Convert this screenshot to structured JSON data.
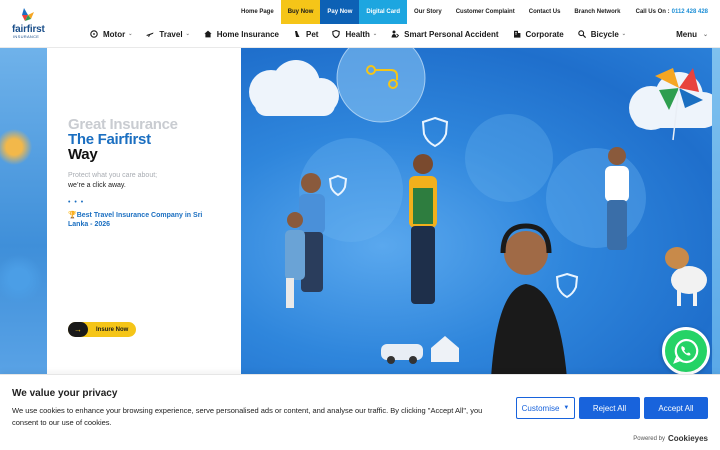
{
  "logo": {
    "wordmark": "fairfirst",
    "sub": "INSURANCE"
  },
  "topbar": {
    "links": [
      "Home Page",
      "Buy Now",
      "Pay Now",
      "Digital Card",
      "Our Story",
      "Customer Complaint",
      "Contact Us",
      "Branch Network"
    ],
    "call_label": "Call Us On :",
    "call_number": "0112 428 428"
  },
  "nav": {
    "items": [
      {
        "label": "Motor",
        "icon": "steering-wheel-icon",
        "dropdown": true
      },
      {
        "label": "Travel",
        "icon": "airplane-icon",
        "dropdown": true
      },
      {
        "label": "Home Insurance",
        "icon": "house-icon",
        "dropdown": false
      },
      {
        "label": "Pet",
        "icon": "paw-icon",
        "dropdown": false
      },
      {
        "label": "Health",
        "icon": "shield-heart-icon",
        "dropdown": true
      },
      {
        "label": "Smart Personal Accident",
        "icon": "person-icon",
        "dropdown": false
      },
      {
        "label": "Corporate",
        "icon": "building-icon",
        "dropdown": false
      },
      {
        "label": "Bicycle",
        "icon": "search-bicycle-icon",
        "dropdown": true
      }
    ],
    "menu_label": "Menu"
  },
  "hero": {
    "line1": "Great Insurance",
    "line2": "The Fairfirst",
    "line3": "Way",
    "sub1": "Protect what you care about;",
    "sub2": "we’re a click away.",
    "dots": "• • •",
    "award": "🏆Best Travel Insurance Company in Sri Lanka - 2026",
    "cta": "Insure Now"
  },
  "cookie": {
    "title": "We value your privacy",
    "text": "We use cookies to enhance your browsing experience, serve personalised ads or content, and analyse our traffic. By clicking \"Accept All\", you consent to our use of cookies.",
    "customise": "Customise",
    "reject": "Reject All",
    "accept": "Accept All",
    "powered_by": "Powered by",
    "brand": "Cookieyes"
  },
  "colors": {
    "brand_blue": "#1b6fc1",
    "buy_yellow": "#f5c518",
    "pay_blue": "#0d61b5",
    "digital_cyan": "#1da6e0",
    "cookie_blue": "#1863dc",
    "whatsapp_green": "#25d366"
  }
}
